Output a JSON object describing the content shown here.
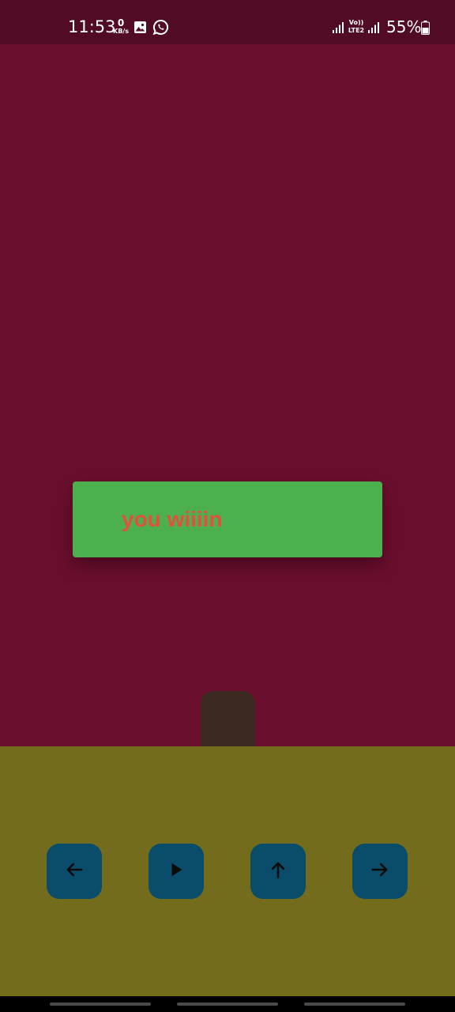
{
  "status_bar": {
    "time": "11:53",
    "net_speed_value": "0",
    "net_speed_unit": "KB/s",
    "volte_line1": "Vo))",
    "volte_line2": "LTE2",
    "battery_percent": "55%",
    "icons": [
      "gallery-icon",
      "whatsapp-icon",
      "signal-icon",
      "volte-icon",
      "signal-icon",
      "battery-icon"
    ]
  },
  "game": {
    "message": "you wiiiin"
  },
  "controls": {
    "buttons": [
      {
        "id": "left",
        "icon": "arrow-left-icon"
      },
      {
        "id": "play",
        "icon": "play-icon"
      },
      {
        "id": "up",
        "icon": "arrow-up-icon"
      },
      {
        "id": "right",
        "icon": "arrow-right-icon"
      }
    ]
  },
  "colors": {
    "status_bar": "#520b26",
    "game_background": "#6b0f2e",
    "banner_background": "#4caf50",
    "banner_text": "#e0523b",
    "player": "#3a2a22",
    "control_background": "#736c1d",
    "control_button": "#0a4d6b"
  }
}
